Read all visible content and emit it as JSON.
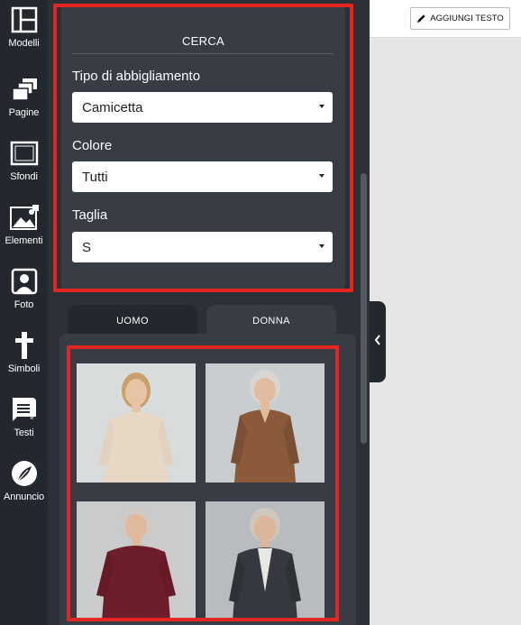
{
  "rail": [
    {
      "label": "Modelli",
      "icon": "layout-icon"
    },
    {
      "label": "Pagine",
      "icon": "pages-icon"
    },
    {
      "label": "Sfondi",
      "icon": "background-icon"
    },
    {
      "label": "Elementi",
      "icon": "image-icon"
    },
    {
      "label": "Foto",
      "icon": "person-photo-icon"
    },
    {
      "label": "Simboli",
      "icon": "cross-icon"
    },
    {
      "label": "Testi",
      "icon": "text-icon"
    },
    {
      "label": "Annuncio",
      "icon": "leaf-icon"
    }
  ],
  "search": {
    "title": "CERCA",
    "clothing_type_label": "Tipo di abbigliamento",
    "clothing_type_value": "Camicetta",
    "color_label": "Colore",
    "color_value": "Tutti",
    "size_label": "Taglia",
    "size_value": "S"
  },
  "tabs": [
    {
      "label": "UOMO",
      "active": false
    },
    {
      "label": "DONNA",
      "active": true
    }
  ],
  "gallery": [
    {
      "name": "woman-beige-top-photo",
      "shirt": "#e6d8c5",
      "bg": "#d9dcdc",
      "hair": "#c9a06a"
    },
    {
      "name": "woman-brown-shirt-photo",
      "shirt": "#8a5a3a",
      "bg": "#c8cdcf",
      "hair": "#d8d6d2"
    },
    {
      "name": "woman-burgundy-top-photo",
      "shirt": "#6e1e2a",
      "bg": "#c9cbcd",
      "hair": "#cfcac4"
    },
    {
      "name": "woman-dark-shirt-photo",
      "shirt": "#35383e",
      "bg": "#b9bcbe",
      "hair": "#cfc7bc"
    }
  ],
  "toolbar": {
    "add_text_label": "AGGIUNGI TESTO",
    "icon": "pencil-icon"
  },
  "colors": {
    "accent_red": "#e52620",
    "rail_bg": "#23272e",
    "panel_bg": "#2d3037",
    "card_bg": "#383c45"
  }
}
